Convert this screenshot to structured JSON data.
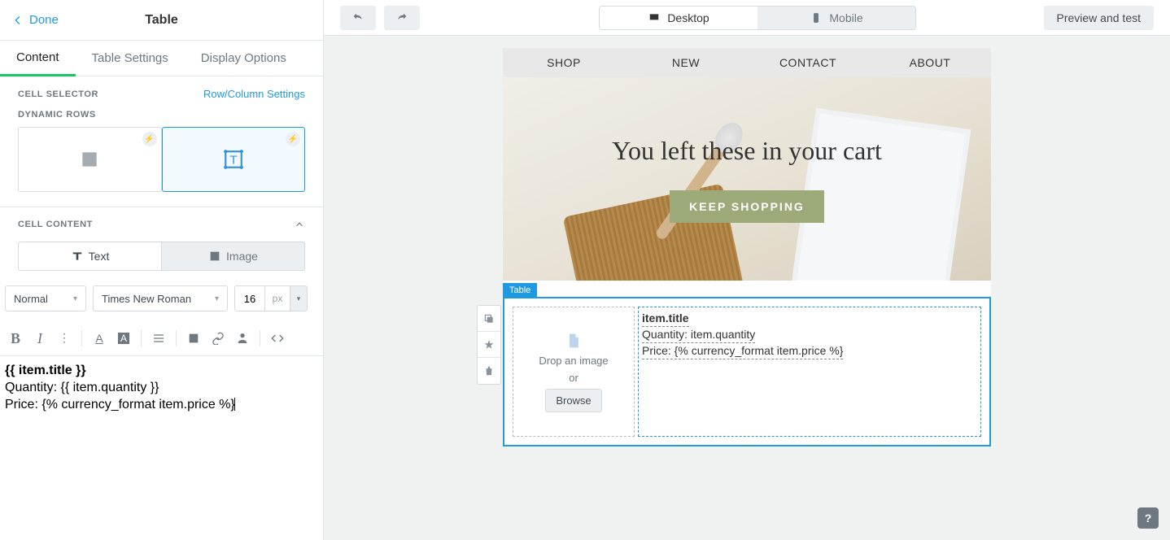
{
  "header": {
    "done": "Done",
    "title": "Table"
  },
  "tabs": [
    "Content",
    "Table Settings",
    "Display Options"
  ],
  "cell_selector": {
    "label": "CELL SELECTOR",
    "link": "Row/Column Settings",
    "dynamic_label": "DYNAMIC ROWS"
  },
  "cell_content": {
    "label": "CELL CONTENT",
    "toggle": {
      "text": "Text",
      "image": "Image"
    },
    "style_sel": "Normal",
    "font_sel": "Times New Roman",
    "size_val": "16",
    "size_unit": "px"
  },
  "editor_lines": [
    "{{ item.title }}",
    "Quantity: {{ item.quantity }}",
    "Price: {% currency_format item.price %}"
  ],
  "topbar": {
    "views": {
      "desktop": "Desktop",
      "mobile": "Mobile"
    },
    "preview": "Preview and test"
  },
  "email": {
    "nav": [
      "SHOP",
      "NEW",
      "CONTACT",
      "ABOUT"
    ],
    "hero_title": "You left these in your cart",
    "hero_button": "KEEP SHOPPING",
    "table_tag": "Table",
    "img_cell": {
      "drop": "Drop an image",
      "or": "or",
      "browse": "Browse"
    },
    "text_lines": {
      "title": "item.title",
      "qty": "Quantity: item.quantity",
      "price": "Price: {% currency_format item.price %}"
    }
  },
  "help": "?"
}
